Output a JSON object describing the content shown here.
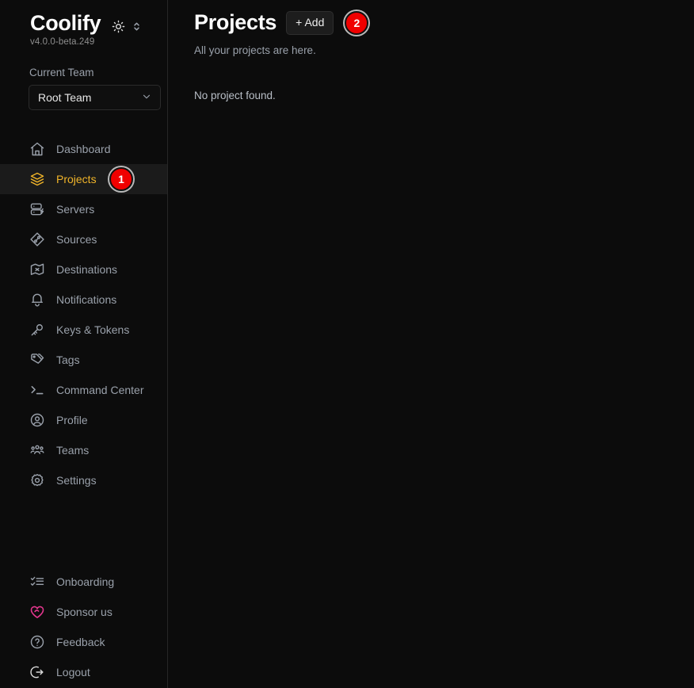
{
  "brand": {
    "name": "Coolify",
    "version": "v4.0.0-beta.249",
    "theme_toggle_icon": "sun-icon",
    "theme_selector_icon": "chevron-up-down-icon"
  },
  "sidebar": {
    "team_label": "Current Team",
    "team_selected": "Root Team",
    "team_chevron_icon": "chevron-down-icon",
    "items": [
      {
        "label": "Dashboard",
        "icon": "home-icon",
        "active": false
      },
      {
        "label": "Projects",
        "icon": "layers-icon",
        "active": true,
        "badge": "1"
      },
      {
        "label": "Servers",
        "icon": "server-icon",
        "active": false
      },
      {
        "label": "Sources",
        "icon": "git-source-icon",
        "active": false
      },
      {
        "label": "Destinations",
        "icon": "map-destination-icon",
        "active": false
      },
      {
        "label": "Notifications",
        "icon": "bell-icon",
        "active": false
      },
      {
        "label": "Keys & Tokens",
        "icon": "key-icon",
        "active": false
      },
      {
        "label": "Tags",
        "icon": "tag-icon",
        "active": false
      },
      {
        "label": "Command Center",
        "icon": "terminal-icon",
        "active": false
      },
      {
        "label": "Profile",
        "icon": "user-circle-icon",
        "active": false
      },
      {
        "label": "Teams",
        "icon": "users-icon",
        "active": false
      },
      {
        "label": "Settings",
        "icon": "gear-icon",
        "active": false
      }
    ],
    "bottom_items": [
      {
        "label": "Onboarding",
        "icon": "checklist-icon"
      },
      {
        "label": "Sponsor us",
        "icon": "heart-icon"
      },
      {
        "label": "Feedback",
        "icon": "question-circle-icon"
      },
      {
        "label": "Logout",
        "icon": "logout-icon"
      }
    ]
  },
  "main": {
    "title": "Projects",
    "add_label": "+ Add",
    "add_badge": "2",
    "subtitle": "All your projects are here.",
    "empty_message": "No project found."
  },
  "colors": {
    "background": "#0c0c0c",
    "active_accent": "#f0b429",
    "badge_red": "#f00000",
    "sponsor_pink": "#e5378f",
    "muted_text": "#9aa1ab",
    "border": "#272727"
  }
}
